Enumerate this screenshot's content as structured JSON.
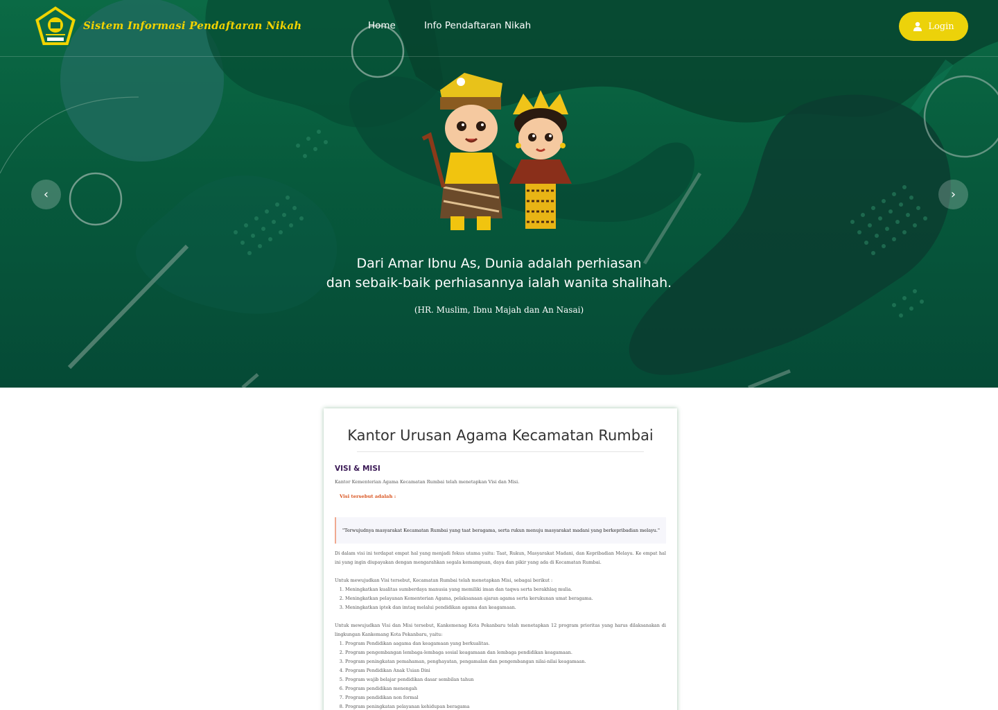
{
  "navbar": {
    "brand": "Sistem Informasi Pendaftaran Nikah",
    "links": [
      "Home",
      "Info Pendaftaran Nikah"
    ],
    "login_label": "Login"
  },
  "hero": {
    "carousel_prev": "‹",
    "carousel_next": "›",
    "quote_line1": "Dari Amar Ibnu As, Dunia adalah perhiasan",
    "quote_line2": "dan sebaik-baik perhiasannya ialah wanita shalihah.",
    "quote_source": "(HR. Muslim, Ibnu Majah dan An Nasai)"
  },
  "colors": {
    "hero_green": "#0b6a45",
    "accent_yellow": "#ecd20a",
    "heading_purple": "#3b1a56",
    "label_orange": "#d9531e"
  },
  "content": {
    "title": "Kantor Urusan Agama Kecamatan Rumbai",
    "section_heading": "VISI & MISI",
    "intro": "Kantor Kementerian Agama Kecamatan Rumbai telah menetapkan Visi dan Misi.",
    "visi_label": "Visi tersebut adalah :",
    "visi_quote": "\"Terwujudnya masyarakat Kecamatan Rumbai yang taat beragama, serta rukun menuju masyarakat madani yang berkepribadian melayu.\"",
    "visi_explanation": "Di dalam visi ini terdapat empat hal yang menjadi fokus utama yaitu: Taat, Rukun, Masyarakat Madani, dan Kepribadian Melayu. Ke empat hal ini yang ingin diupayakan dengan mengarahkan segala kemampuan, daya dan pikir yang ada di Kecamatan Rumbai.",
    "misi_intro": "Untuk mewujudkan Visi tersebut, Kecamatan Rumbai telah menetapkan Misi, sebagai berikut :",
    "misi_items": [
      "Meningkatkan kualitas sumberdaya manusia yang memiliki iman dan taqwa serta berakhlaq mulia.",
      "Meningkatkan pelayanan Kementerian Agama, pelaksanaan ajaran agama serta kerukunan umat beragama.",
      "Meningkatkan iptek dan imtaq melalui pendidikan agama dan keagamaan."
    ],
    "program_intro": "Untuk mewujudkan Visi dan Misi tersebut, Kankemenag Kota Pekanbaru telah menetapkan 12 program prioritas yang harus dilaksanakan di lingkungan Kankemang Kota Pekanbaru, yaitu:",
    "program_items": [
      "Program Pendidikan aagama dan keagamaan yang berkualitas.",
      "Program pengembangan lembaga-lembaga sosial keagamaan dan lembaga pendidikan keagamaan.",
      "Program peningkatan pemahaman, penghayatan, pengamalan dan pengembangan nilai-nilai keagamaan.",
      "Program Pendidikan Anak Usian Dini",
      "Program wajib belajar pendidikan dasar sembilan tahun",
      "Program pendidikan menengah",
      "Program pendidikan non formal",
      "Program peningkatan pelayanan kehidupan beragama"
    ]
  }
}
